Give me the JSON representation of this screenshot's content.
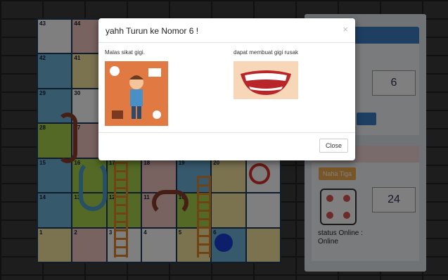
{
  "board": {
    "cells": [
      {
        "num": "43",
        "cls": "w"
      },
      {
        "num": "44",
        "cls": "p"
      },
      {
        "num": "",
        "cls": "w"
      },
      {
        "num": "",
        "cls": "w"
      },
      {
        "num": "",
        "cls": "w"
      },
      {
        "num": "",
        "cls": "w"
      },
      {
        "num": "",
        "cls": "w"
      },
      {
        "num": "42",
        "cls": "b"
      },
      {
        "num": "41",
        "cls": "y"
      },
      {
        "num": "",
        "cls": "w"
      },
      {
        "num": "",
        "cls": "w"
      },
      {
        "num": "",
        "cls": "w"
      },
      {
        "num": "",
        "cls": "w"
      },
      {
        "num": "",
        "cls": "w"
      },
      {
        "num": "29",
        "cls": "b"
      },
      {
        "num": "30",
        "cls": "w"
      },
      {
        "num": "",
        "cls": "w"
      },
      {
        "num": "",
        "cls": "w"
      },
      {
        "num": "",
        "cls": "w"
      },
      {
        "num": "",
        "cls": "w"
      },
      {
        "num": "",
        "cls": "w"
      },
      {
        "num": "28",
        "cls": "g"
      },
      {
        "num": "27",
        "cls": "p"
      },
      {
        "num": "",
        "cls": "w"
      },
      {
        "num": "",
        "cls": "w"
      },
      {
        "num": "",
        "cls": "w"
      },
      {
        "num": "",
        "cls": "w"
      },
      {
        "num": "",
        "cls": "w"
      },
      {
        "num": "15",
        "cls": "b"
      },
      {
        "num": "16",
        "cls": "g"
      },
      {
        "num": "17",
        "cls": "g"
      },
      {
        "num": "18",
        "cls": "p"
      },
      {
        "num": "19",
        "cls": "b"
      },
      {
        "num": "20",
        "cls": "y"
      },
      {
        "num": "",
        "cls": "w"
      },
      {
        "num": "14",
        "cls": "b"
      },
      {
        "num": "13",
        "cls": "g"
      },
      {
        "num": "12",
        "cls": "g"
      },
      {
        "num": "11",
        "cls": "p"
      },
      {
        "num": "10",
        "cls": "g"
      },
      {
        "num": "",
        "cls": "y"
      },
      {
        "num": "",
        "cls": "w"
      },
      {
        "num": "1",
        "cls": "y"
      },
      {
        "num": "2",
        "cls": "p"
      },
      {
        "num": "3",
        "cls": "w"
      },
      {
        "num": "4",
        "cls": "w"
      },
      {
        "num": "5",
        "cls": "y"
      },
      {
        "num": "6",
        "cls": "b"
      },
      {
        "num": "",
        "cls": "y"
      }
    ]
  },
  "player1": {
    "score": "6"
  },
  "player2": {
    "button_label": "Naha Tiga",
    "score": "24"
  },
  "status": {
    "line1": "status Online :",
    "line2": "Online"
  },
  "modal": {
    "title": "yahh Turun ke Nomor 6 !",
    "close_x": "×",
    "left_text": "Malas sikat gigi.",
    "right_text": "dapat membuat gigi rusak",
    "close_label": "Close"
  }
}
